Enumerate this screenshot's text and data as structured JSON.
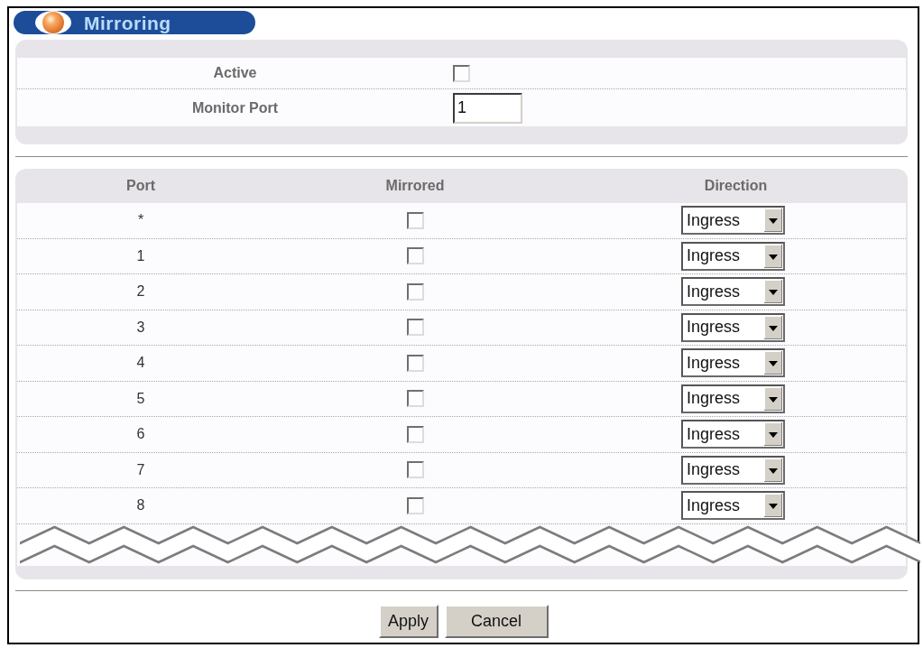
{
  "title": "Mirroring",
  "settings": {
    "active": {
      "label": "Active",
      "checked": false
    },
    "monitor_port": {
      "label": "Monitor Port",
      "value": "1"
    }
  },
  "table": {
    "columns": [
      "Port",
      "Mirrored",
      "Direction"
    ],
    "rows": [
      {
        "port": "*",
        "mirrored": false,
        "direction": "Ingress"
      },
      {
        "port": "1",
        "mirrored": false,
        "direction": "Ingress"
      },
      {
        "port": "2",
        "mirrored": false,
        "direction": "Ingress"
      },
      {
        "port": "3",
        "mirrored": false,
        "direction": "Ingress"
      },
      {
        "port": "4",
        "mirrored": false,
        "direction": "Ingress"
      },
      {
        "port": "5",
        "mirrored": false,
        "direction": "Ingress"
      },
      {
        "port": "6",
        "mirrored": false,
        "direction": "Ingress"
      },
      {
        "port": "7",
        "mirrored": false,
        "direction": "Ingress"
      },
      {
        "port": "8",
        "mirrored": false,
        "direction": "Ingress"
      }
    ]
  },
  "buttons": [
    "Apply",
    "Cancel"
  ]
}
